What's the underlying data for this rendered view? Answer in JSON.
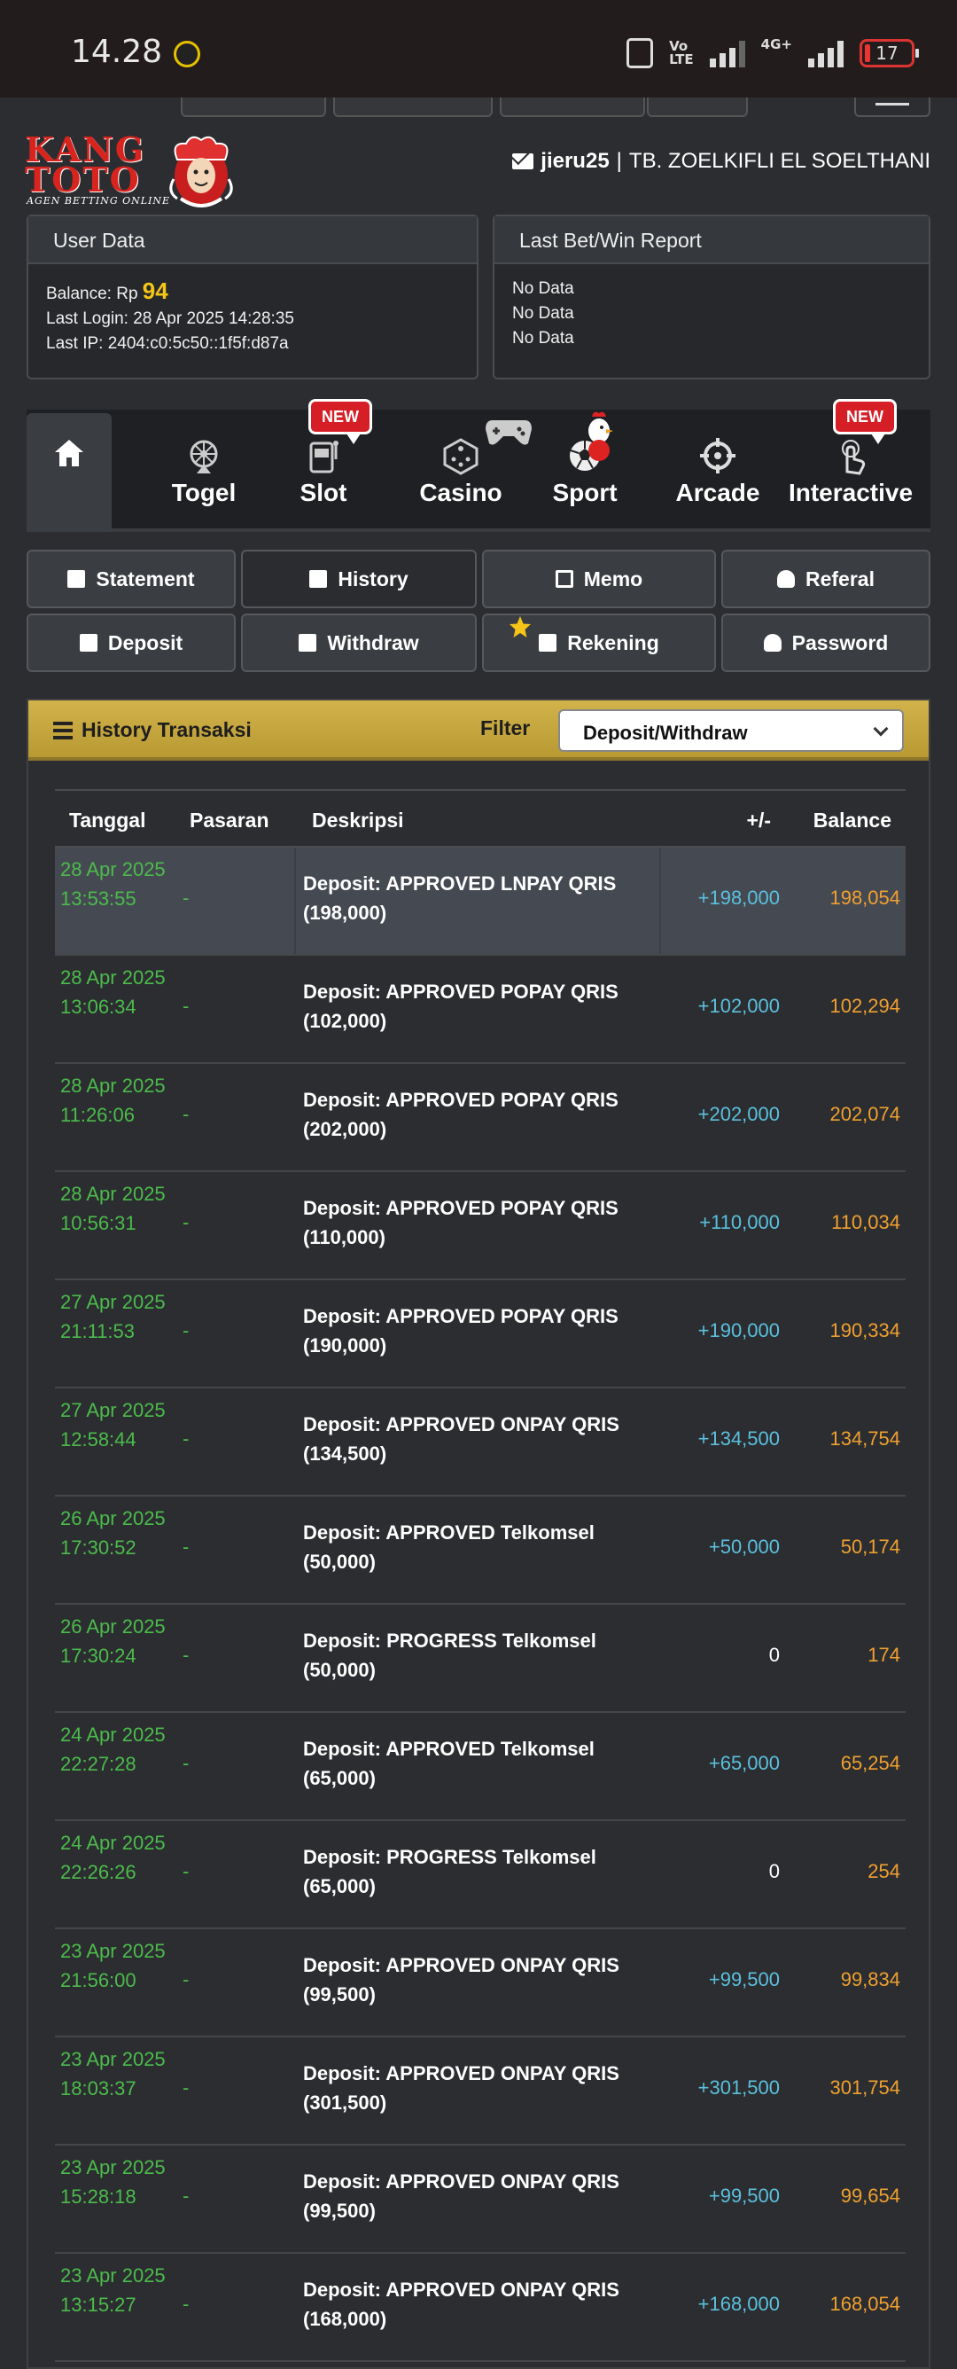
{
  "status_bar": {
    "time": "14.28",
    "volte": "Vo\nLTE",
    "network": "4G+",
    "battery": "17"
  },
  "logo": {
    "line1": "KANG",
    "line2": "TOTO",
    "tagline": "AGEN BETTING ONLINE"
  },
  "user": {
    "username": "jieru25",
    "separator": "|",
    "name": "TB. ZOELKIFLI EL SOELTHANI"
  },
  "user_data": {
    "title": "User Data",
    "balance_label": "Balance: Rp",
    "balance_value": "94",
    "last_login": "Last Login: 28 Apr 2025 14:28:35",
    "last_ip": "Last IP: 2404:c0:5c50::1f5f:d87a"
  },
  "report": {
    "title": "Last Bet/Win Report",
    "lines": [
      "No Data",
      "No Data",
      "No Data"
    ]
  },
  "game_tabs": [
    {
      "label": "Togel",
      "icon": "lottery-wheel-icon"
    },
    {
      "label": "Slot",
      "icon": "slot-machine-icon",
      "badge": "NEW"
    },
    {
      "label": "Casino",
      "icon": "dice-icon"
    },
    {
      "label": "Sport",
      "icon": "soccer-ball-icon"
    },
    {
      "label": "Arcade",
      "icon": "crosshair-icon"
    },
    {
      "label": "Interactive",
      "icon": "touch-hand-icon",
      "badge": "NEW"
    }
  ],
  "account_buttons": [
    {
      "label": "Statement",
      "icon": "calendar-icon"
    },
    {
      "label": "History",
      "icon": "calendar-icon",
      "active": true
    },
    {
      "label": "Memo",
      "icon": "edit-icon"
    },
    {
      "label": "Referal",
      "icon": "user-icon"
    },
    {
      "label": "Deposit",
      "icon": "deposit-icon"
    },
    {
      "label": "Withdraw",
      "icon": "withdraw-icon"
    },
    {
      "label": "Rekening",
      "icon": "briefcase-icon"
    },
    {
      "label": "Password",
      "icon": "user-icon"
    }
  ],
  "history": {
    "title": "History Transaksi",
    "filter_label": "Filter",
    "filter_value": "Deposit/Withdraw",
    "columns": [
      "Tanggal",
      "Pasaran",
      "Deskripsi",
      "+/-",
      "Balance"
    ],
    "rows": [
      {
        "date": "28 Apr 2025 13:53:55",
        "pasaran": "-",
        "desc": "Deposit: APPROVED LNPAY QRIS (198,000)",
        "amount": "+198,000",
        "balance": "198,054"
      },
      {
        "date": "28 Apr 2025 13:06:34",
        "pasaran": "-",
        "desc": "Deposit: APPROVED POPAY QRIS (102,000)",
        "amount": "+102,000",
        "balance": "102,294"
      },
      {
        "date": "28 Apr 2025 11:26:06",
        "pasaran": "-",
        "desc": "Deposit: APPROVED POPAY QRIS (202,000)",
        "amount": "+202,000",
        "balance": "202,074"
      },
      {
        "date": "28 Apr 2025 10:56:31",
        "pasaran": "-",
        "desc": "Deposit: APPROVED POPAY QRIS (110,000)",
        "amount": "+110,000",
        "balance": "110,034"
      },
      {
        "date": "27 Apr 2025 21:11:53",
        "pasaran": "-",
        "desc": "Deposit: APPROVED POPAY QRIS (190,000)",
        "amount": "+190,000",
        "balance": "190,334"
      },
      {
        "date": "27 Apr 2025 12:58:44",
        "pasaran": "-",
        "desc": "Deposit: APPROVED ONPAY QRIS (134,500)",
        "amount": "+134,500",
        "balance": "134,754"
      },
      {
        "date": "26 Apr 2025 17:30:52",
        "pasaran": "-",
        "desc": "Deposit: APPROVED Telkomsel (50,000)",
        "amount": "+50,000",
        "balance": "50,174"
      },
      {
        "date": "26 Apr 2025 17:30:24",
        "pasaran": "-",
        "desc": "Deposit: PROGRESS Telkomsel (50,000)",
        "amount": "0",
        "balance": "174"
      },
      {
        "date": "24 Apr 2025 22:27:28",
        "pasaran": "-",
        "desc": "Deposit: APPROVED Telkomsel (65,000)",
        "amount": "+65,000",
        "balance": "65,254"
      },
      {
        "date": "24 Apr 2025 22:26:26",
        "pasaran": "-",
        "desc": "Deposit: PROGRESS Telkomsel (65,000)",
        "amount": "0",
        "balance": "254"
      },
      {
        "date": "23 Apr 2025 21:56:00",
        "pasaran": "-",
        "desc": "Deposit: APPROVED ONPAY QRIS (99,500)",
        "amount": "+99,500",
        "balance": "99,834"
      },
      {
        "date": "23 Apr 2025 18:03:37",
        "pasaran": "-",
        "desc": "Deposit: APPROVED ONPAY QRIS (301,500)",
        "amount": "+301,500",
        "balance": "301,754"
      },
      {
        "date": "23 Apr 2025 15:28:18",
        "pasaran": "-",
        "desc": "Deposit: APPROVED ONPAY QRIS (99,500)",
        "amount": "+99,500",
        "balance": "99,654"
      },
      {
        "date": "23 Apr 2025 13:15:27",
        "pasaran": "-",
        "desc": "Deposit: APPROVED ONPAY QRIS (168,000)",
        "amount": "+168,000",
        "balance": "168,054"
      }
    ]
  },
  "colors": {
    "date": "#4cbb4c",
    "amount": "#5bc0de",
    "balance": "#f0a030",
    "header_gold": "#c9aa42",
    "badge_red": "#d51e26"
  }
}
